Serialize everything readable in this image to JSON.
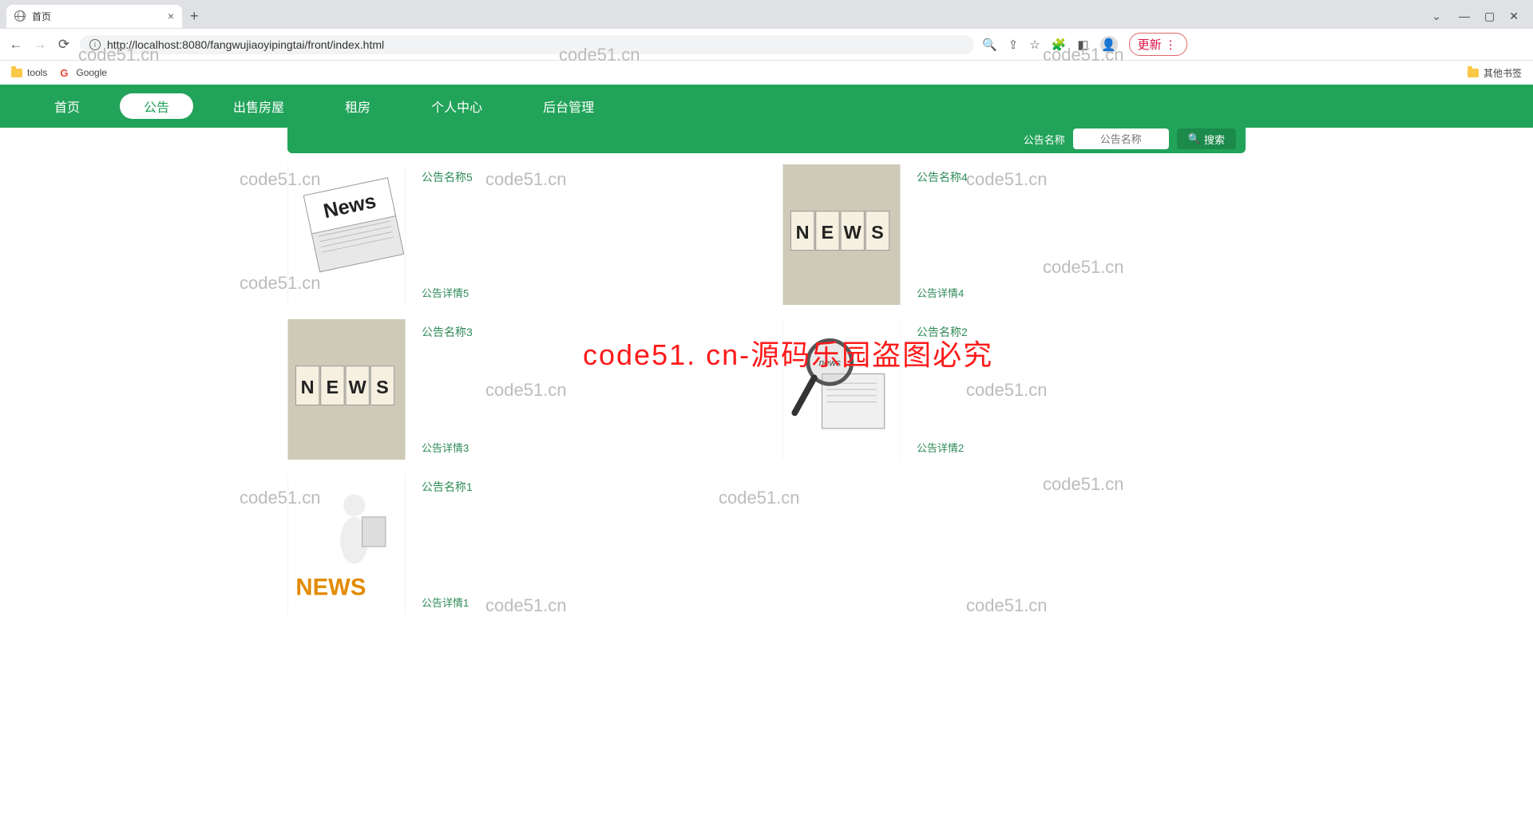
{
  "browser": {
    "tab_title": "首页",
    "url_display": "http://localhost:8080/fangwujiaoyipingtai/front/index.html",
    "url_host": "localhost",
    "update_label": "更新",
    "bookmarks": {
      "tools": "tools",
      "google": "Google",
      "other": "其他书签"
    }
  },
  "nav": {
    "items": [
      "首页",
      "公告",
      "出售房屋",
      "租房",
      "个人中心",
      "后台管理"
    ],
    "active_index": 1
  },
  "search": {
    "label": "公告名称",
    "placeholder": "公告名称",
    "button": "搜索"
  },
  "cards": [
    {
      "title": "公告名称5",
      "detail": "公告详情5",
      "thumb": "news-paper-folded"
    },
    {
      "title": "公告名称4",
      "detail": "公告详情4",
      "thumb": "news-blocks"
    },
    {
      "title": "公告名称3",
      "detail": "公告详情3",
      "thumb": "news-blocks"
    },
    {
      "title": "公告名称2",
      "detail": "公告详情2",
      "thumb": "news-magnifier"
    },
    {
      "title": "公告名称1",
      "detail": "公告详情1",
      "thumb": "news-figure"
    }
  ],
  "watermark": {
    "text": "code51.cn",
    "big_red": "code51. cn-源码乐园盗图必究"
  }
}
